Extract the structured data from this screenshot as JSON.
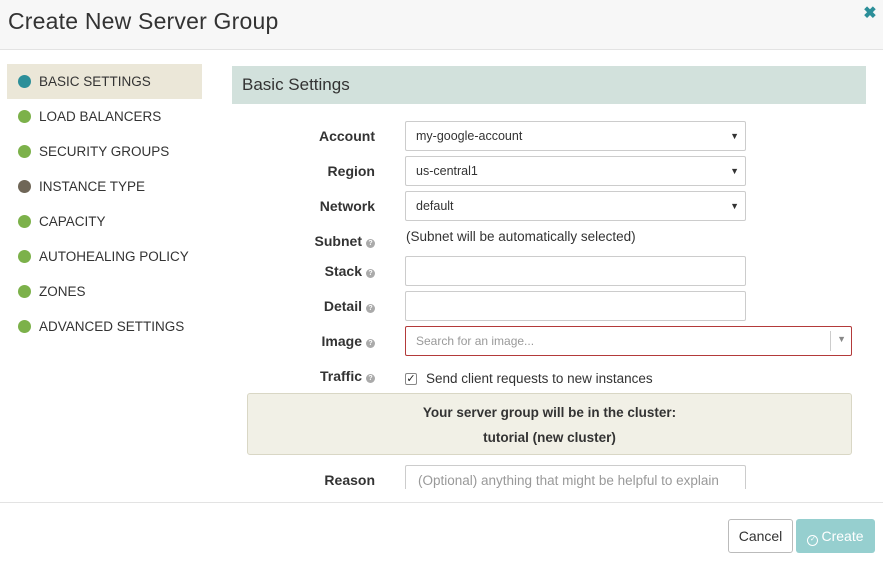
{
  "header": {
    "title": "Create New Server Group",
    "close_icon": "close-icon"
  },
  "sidebar": {
    "items": [
      {
        "label": "BASIC SETTINGS",
        "color": "#2c8f99",
        "active": true
      },
      {
        "label": "LOAD BALANCERS",
        "color": "#7cb14a"
      },
      {
        "label": "SECURITY GROUPS",
        "color": "#7cb14a"
      },
      {
        "label": "INSTANCE TYPE",
        "color": "#6f6657"
      },
      {
        "label": "CAPACITY",
        "color": "#7cb14a"
      },
      {
        "label": "AUTOHEALING POLICY",
        "color": "#7cb14a"
      },
      {
        "label": "ZONES",
        "color": "#7cb14a"
      },
      {
        "label": "ADVANCED SETTINGS",
        "color": "#7cb14a"
      }
    ]
  },
  "section": {
    "title": "Basic Settings"
  },
  "form": {
    "account": {
      "label": "Account",
      "value": "my-google-account"
    },
    "region": {
      "label": "Region",
      "value": "us-central1"
    },
    "network": {
      "label": "Network",
      "value": "default"
    },
    "subnet": {
      "label": "Subnet",
      "text": "(Subnet will be automatically selected)"
    },
    "stack": {
      "label": "Stack",
      "value": ""
    },
    "detail": {
      "label": "Detail",
      "value": ""
    },
    "image": {
      "label": "Image",
      "placeholder": "Search for an image..."
    },
    "traffic": {
      "label": "Traffic",
      "checkbox_label": "Send client requests to new instances",
      "checked": true
    },
    "reason": {
      "label": "Reason",
      "placeholder": "(Optional) anything that might be helpful to explain"
    }
  },
  "cluster": {
    "line1": "Your server group will be in the cluster:",
    "line2": "tutorial (new cluster)"
  },
  "footer": {
    "cancel_label": "Cancel",
    "create_label": "Create"
  },
  "colors": {
    "accent": "#2c8f99",
    "section_header_bg": "#d2e1dc",
    "active_nav_bg": "#ebe7d8",
    "create_button_bg": "#96cfcf",
    "error_border": "#b33a3a"
  }
}
